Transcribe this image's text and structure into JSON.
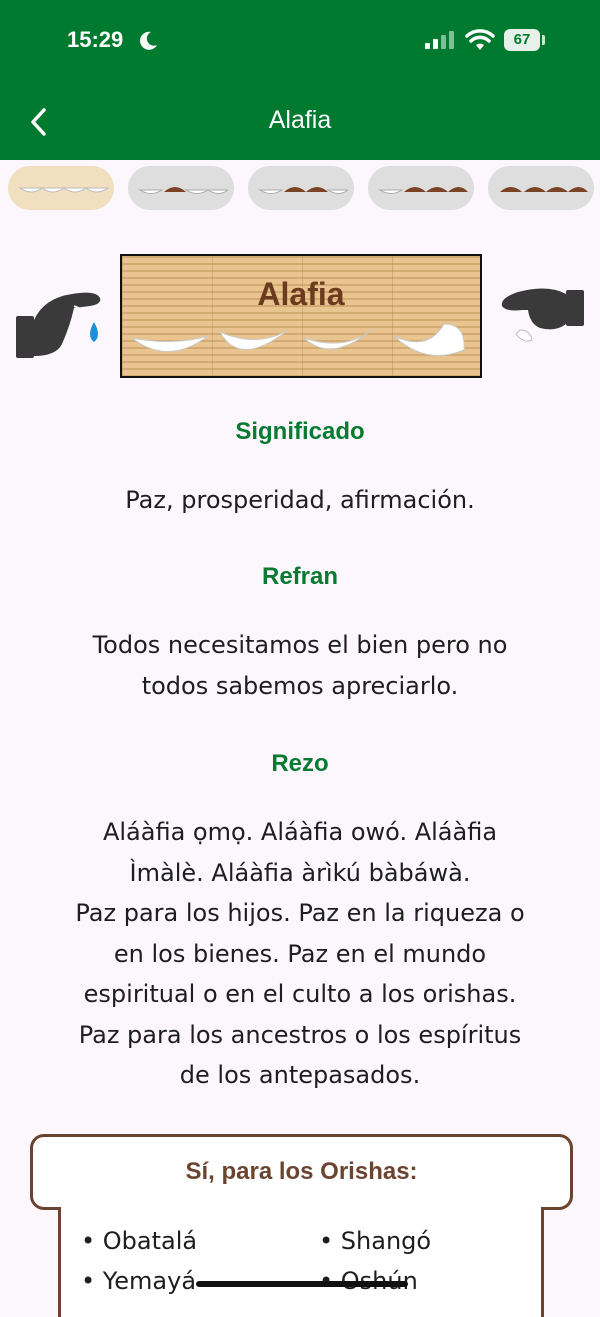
{
  "status_bar": {
    "time": "15:29",
    "battery": "67"
  },
  "header": {
    "title": "Alafia"
  },
  "tabs": [
    {
      "name": "tab-alafia",
      "active": true
    },
    {
      "name": "tab-otawe",
      "active": false
    },
    {
      "name": "tab-eyeife",
      "active": false
    },
    {
      "name": "tab-okana",
      "active": false
    },
    {
      "name": "tab-oyeku",
      "active": false
    }
  ],
  "figure": {
    "mat_title": "Alafia"
  },
  "significado": {
    "heading": "Significado",
    "line1": "Paz, prosperidad, afirmación."
  },
  "refran": {
    "heading": "Refran",
    "line1": "Todos necesitamos el bien pero no",
    "line2": "todos sabemos apreciarlo."
  },
  "rezo": {
    "heading": "Rezo",
    "lines": [
      "Aláàfia ọmọ. Aláàfia owó. Aláàfia",
      "Ìmàlè. Aláàfia àrìkú bàbáwà.",
      "Paz para los hijos. Paz en la riqueza o",
      "en los bienes. Paz en el mundo",
      "espiritual o en el culto a los orishas.",
      "Paz para los ancestros o los espíritus",
      "de los antepasados."
    ]
  },
  "orishas": {
    "heading": "Sí, para los Orishas:",
    "items": [
      "• Obatalá",
      "• Shangó",
      "• Yemayá",
      "• Oshún"
    ]
  },
  "colors": {
    "header": "#007a2e",
    "heading_green": "#0a7a33",
    "brown": "#6b4430"
  }
}
